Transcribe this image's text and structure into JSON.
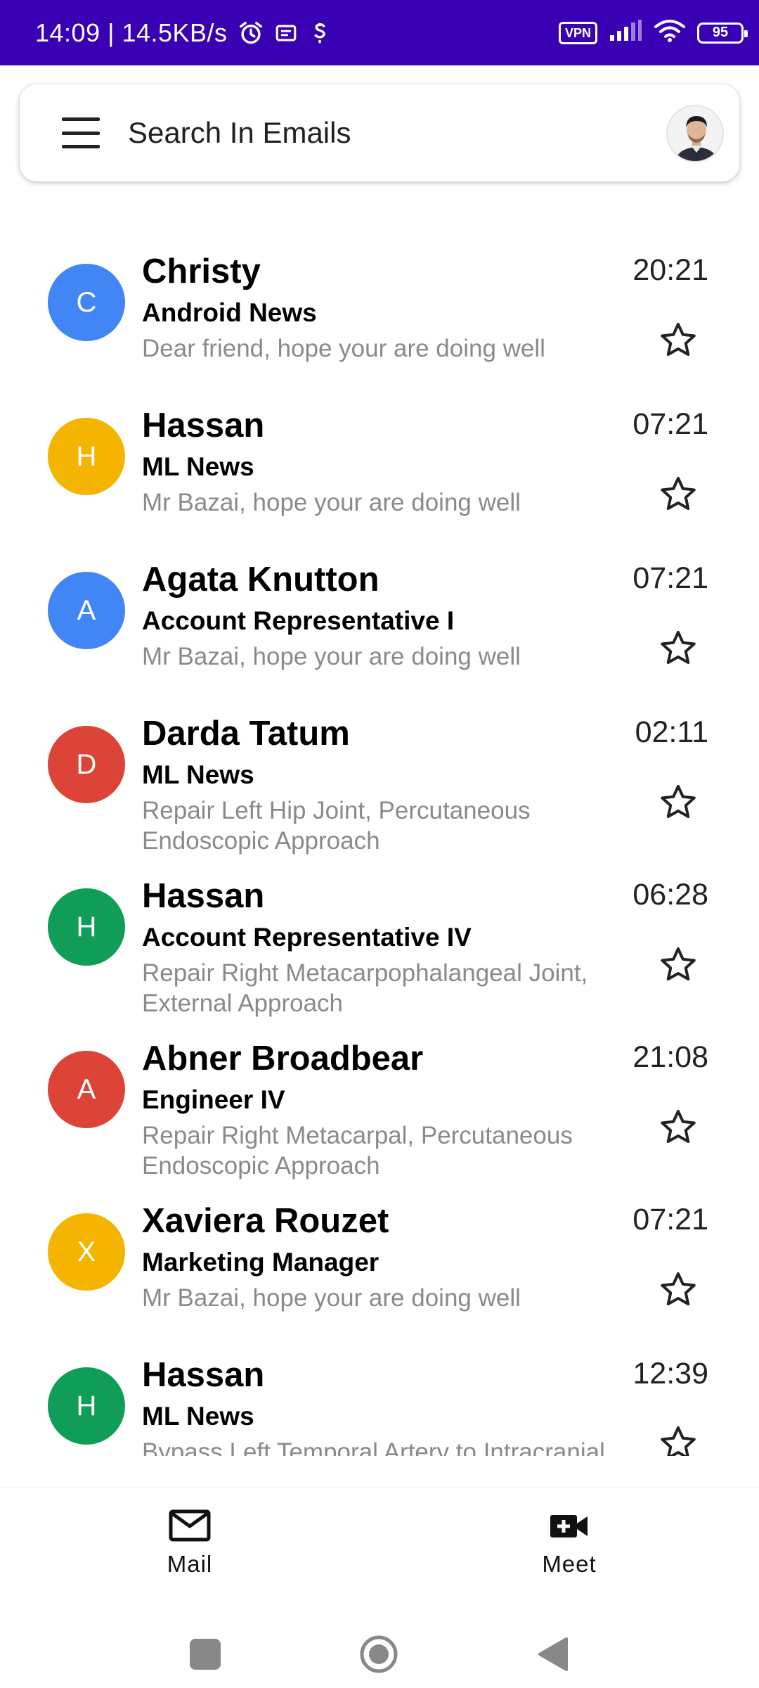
{
  "status_bar": {
    "time": "14:09",
    "speed": "14.5KB/s",
    "vpn_label": "VPN",
    "battery": "95",
    "background": "#3a00b4"
  },
  "search": {
    "placeholder": "Search In Emails"
  },
  "emails": [
    {
      "initial": "C",
      "color": "#4285f4",
      "sender": "Christy",
      "subject": "Android News",
      "preview": "Dear friend, hope your are doing well",
      "time": "20:21"
    },
    {
      "initial": "H",
      "color": "#f4b400",
      "sender": "Hassan",
      "subject": "ML News",
      "preview": "Mr Bazai, hope your are doing well",
      "time": "07:21"
    },
    {
      "initial": "A",
      "color": "#4285f4",
      "sender": "Agata Knutton",
      "subject": "Account Representative I",
      "preview": "Mr Bazai, hope your are doing well",
      "time": "07:21"
    },
    {
      "initial": "D",
      "color": "#db4437",
      "sender": "Darda Tatum",
      "subject": "ML News",
      "preview": "Repair Left Hip Joint, Percutaneous Endoscopic Approach",
      "time": "02:11"
    },
    {
      "initial": "H",
      "color": "#0f9d58",
      "sender": "Hassan",
      "subject": "Account Representative IV",
      "preview": "Repair Right Metacarpophalangeal Joint, External Approach",
      "time": "06:28"
    },
    {
      "initial": "A",
      "color": "#db4437",
      "sender": "Abner Broadbear",
      "subject": "Engineer IV",
      "preview": "Repair Right Metacarpal, Percutaneous Endoscopic Approach",
      "time": "21:08"
    },
    {
      "initial": "X",
      "color": "#f4b400",
      "sender": "Xaviera Rouzet",
      "subject": "Marketing Manager",
      "preview": "Mr Bazai, hope your are doing well",
      "time": "07:21"
    },
    {
      "initial": "H",
      "color": "#0f9d58",
      "sender": "Hassan",
      "subject": "ML News",
      "preview": "Bypass Left Temporal Artery to Intracranial",
      "time": "12:39"
    }
  ],
  "bottom_nav": {
    "mail_label": "Mail",
    "meet_label": "Meet"
  }
}
